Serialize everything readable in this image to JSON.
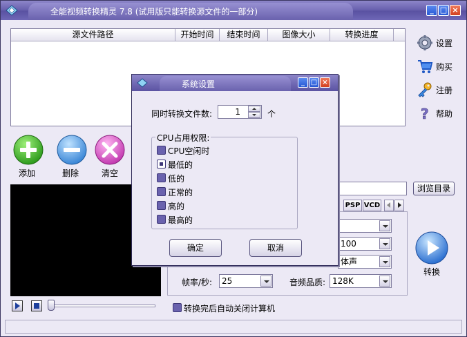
{
  "window": {
    "title": "全能视频转换精灵 7.8 (试用版只能转换源文件的一部分)",
    "min_glyph": "_",
    "max_glyph": "□",
    "close_glyph": "×"
  },
  "file_list": {
    "columns": [
      "源文件路径",
      "开始时间",
      "结束时间",
      "图像大小",
      "转换进度"
    ]
  },
  "right_toolbar": {
    "settings": "设置",
    "buy": "购买",
    "register": "注册",
    "help": "帮助"
  },
  "actions": {
    "add": "添加",
    "delete": "删除",
    "clear": "清空"
  },
  "output": {
    "browse": "浏览目录"
  },
  "format_tabs": [
    "PSP",
    "VCD"
  ],
  "fields": {
    "bitrate_value": "100",
    "audio_channel_value": "体声",
    "framerate_label": "帧率/秒:",
    "framerate_value": "25",
    "audio_quality_label": "音频品质:",
    "audio_quality_value": "128K"
  },
  "convert_label": "转换",
  "auto_shutdown_label": "转换完后自动关闭计算机",
  "dialog": {
    "title": "系统设置",
    "concurrent_label": "同时转换文件数:",
    "concurrent_value": "1",
    "concurrent_unit": "个",
    "cpu_group_title": "CPU占用权限:",
    "cpu_options": [
      "CPU空闲时",
      "最低的",
      "低的",
      "正常的",
      "高的",
      "最高的"
    ],
    "cpu_selected": 1,
    "ok": "确定",
    "cancel": "取消"
  },
  "colors": {
    "accent": "#6a62ae",
    "titlebar": "#5a52a2",
    "window_bg": "#ece9f5"
  }
}
